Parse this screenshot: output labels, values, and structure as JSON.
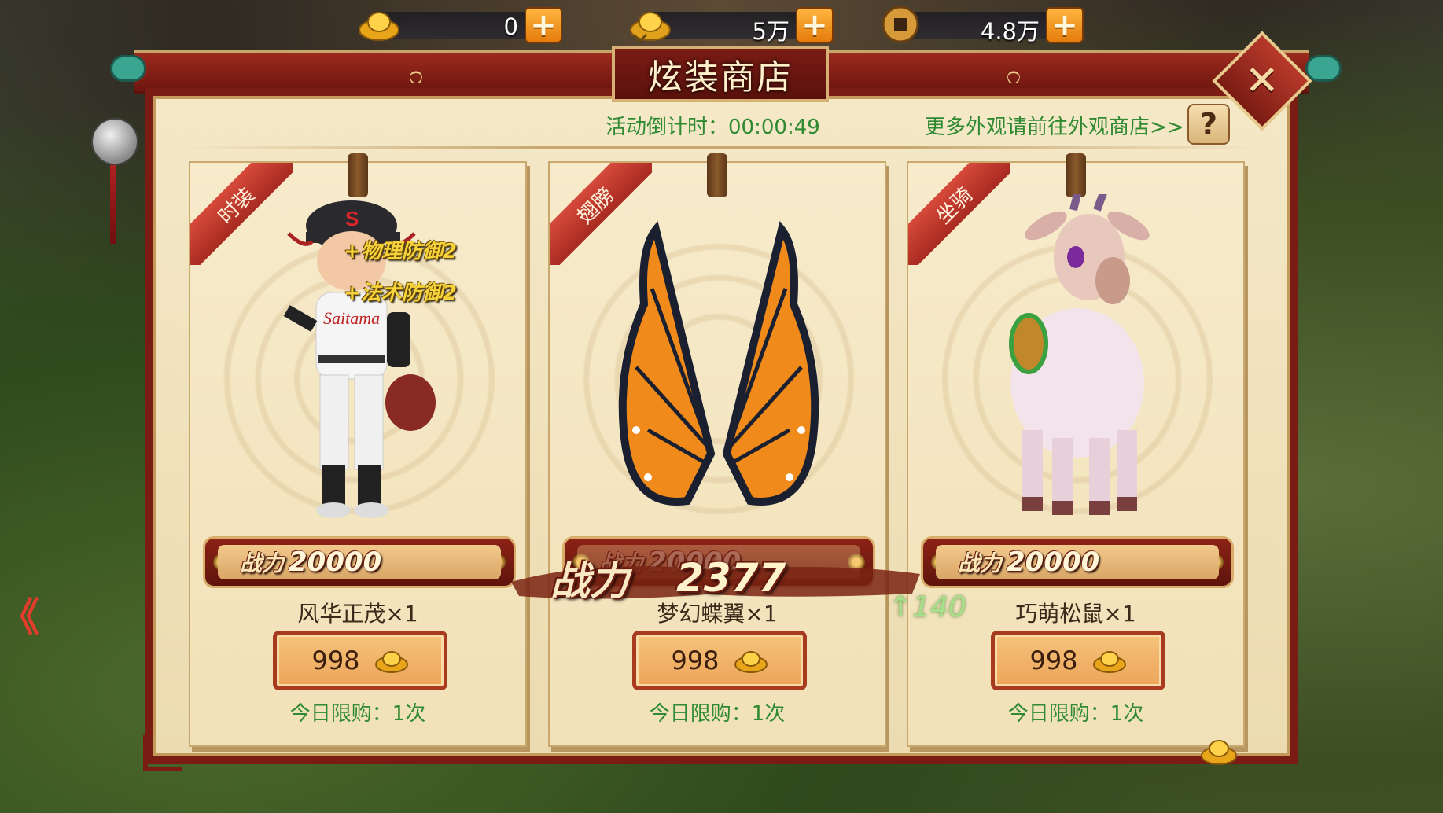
{
  "currencies": [
    {
      "name": "gold-ingot",
      "value": "0"
    },
    {
      "name": "bound-ingot",
      "value": "5万"
    },
    {
      "name": "copper-coin",
      "value": "4.8万"
    }
  ],
  "shop": {
    "title": "炫装商店",
    "countdown_label": "活动倒计时：",
    "countdown_value": "00:00:49",
    "more_link": "更多外观请前往外观商店>>",
    "help": "?",
    "close": "✕"
  },
  "cards": [
    {
      "tag": "时装",
      "buffs": [
        "+物理防御2",
        "+法术防御2"
      ],
      "power_label": "战力",
      "power_value": "20000",
      "name": "风华正茂×1",
      "price": "998",
      "limit": "今日限购：1次"
    },
    {
      "tag": "翅膀",
      "power_label": "战力",
      "power_value": "20000",
      "name": "梦幻蝶翼×1",
      "price": "998",
      "limit": "今日限购：1次"
    },
    {
      "tag": "坐骑",
      "power_label": "战力",
      "power_value": "20000",
      "name": "巧萌松鼠×1",
      "price": "998",
      "limit": "今日限购：1次"
    }
  ],
  "floating_power": {
    "label": "战力",
    "value": "2377",
    "delta": "↑140"
  },
  "colors": {
    "panel_frame": "#7a1c14",
    "parchment": "#f4e8c7",
    "green_text": "#2f8a32",
    "plus_button": "#f29a26"
  }
}
